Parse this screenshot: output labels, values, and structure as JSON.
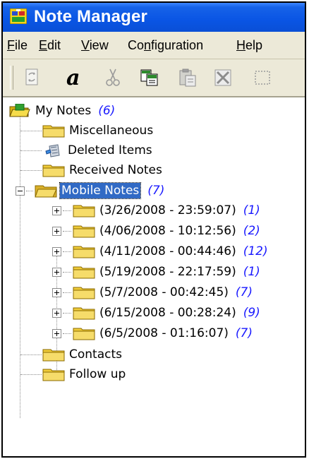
{
  "window": {
    "title": "Note Manager"
  },
  "menu": [
    {
      "pre": "",
      "key": "F",
      "post": "ile"
    },
    {
      "pre": "",
      "key": "E",
      "post": "dit"
    },
    {
      "pre": "",
      "key": "V",
      "post": "iew"
    },
    {
      "pre": "Co",
      "key": "n",
      "post": "figuration"
    },
    {
      "pre": "",
      "key": "H",
      "post": "elp"
    }
  ],
  "toolbar": {
    "icons": [
      "sync-icon",
      "font-icon",
      "cut-icon",
      "copy-icon",
      "paste-icon",
      "delete-icon",
      "select-icon"
    ]
  },
  "tree": {
    "root": {
      "label": "My Notes",
      "count": "(6)"
    },
    "items": [
      {
        "label": "Miscellaneous"
      },
      {
        "label": "Deleted Items"
      },
      {
        "label": "Received Notes"
      },
      {
        "label": "Mobile Notes",
        "count": "(7)"
      },
      {
        "label": "Contacts"
      },
      {
        "label": "Follow up"
      }
    ],
    "mobile_children": [
      {
        "label": "(3/26/2008 - 23:59:07)",
        "count": "(1)"
      },
      {
        "label": "(4/06/2008 - 10:12:56)",
        "count": "(2)"
      },
      {
        "label": "(4/11/2008 - 00:44:46)",
        "count": "(12)"
      },
      {
        "label": "(5/19/2008 - 22:17:59)",
        "count": "(1)"
      },
      {
        "label": "(5/7/2008 - 00:42:45)",
        "count": "(7)"
      },
      {
        "label": "(6/15/2008 - 00:28:24)",
        "count": "(9)"
      },
      {
        "label": "(6/5/2008 - 01:16:07)",
        "count": "(7)"
      }
    ]
  }
}
